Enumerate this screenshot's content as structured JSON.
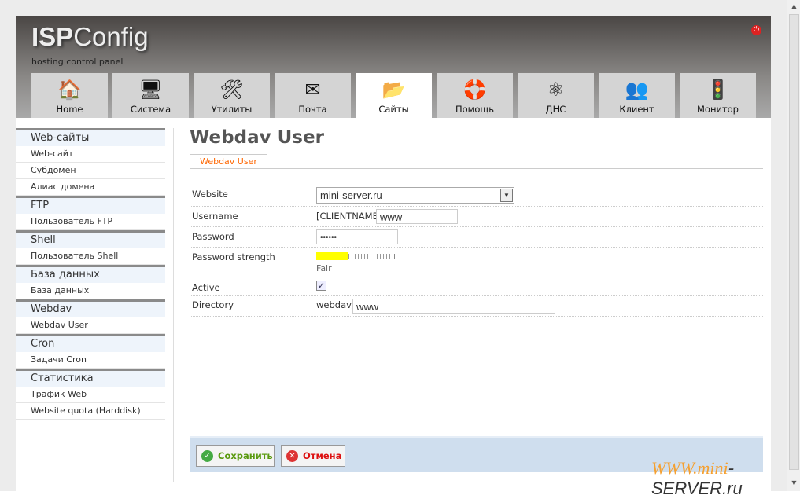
{
  "header": {
    "logo_bold": "ISP",
    "logo_rest": "Config",
    "tagline": "hosting control panel"
  },
  "tabs": [
    {
      "label": "Home",
      "icon": "🏠"
    },
    {
      "label": "Система",
      "icon": "🖥"
    },
    {
      "label": "Утилиты",
      "icon": "🛠"
    },
    {
      "label": "Почта",
      "icon": "✉"
    },
    {
      "label": "Сайты",
      "icon": "📂",
      "active": true
    },
    {
      "label": "Помощь",
      "icon": "🛟"
    },
    {
      "label": "ДНС",
      "icon": "⚛"
    },
    {
      "label": "Клиент",
      "icon": "👥"
    },
    {
      "label": "Монитор",
      "icon": "🚦"
    }
  ],
  "sidebar": [
    {
      "title": "Web-сайты",
      "items": [
        "Web-сайт",
        "Субдомен",
        "Алиас домена"
      ]
    },
    {
      "title": "FTP",
      "items": [
        "Пользователь FTP"
      ]
    },
    {
      "title": "Shell",
      "items": [
        "Пользователь Shell"
      ]
    },
    {
      "title": "База данных",
      "items": [
        "База данных"
      ]
    },
    {
      "title": "Webdav",
      "items": [
        "Webdav User"
      ]
    },
    {
      "title": "Cron",
      "items": [
        "Задачи Cron"
      ]
    },
    {
      "title": "Статистика",
      "items": [
        "Трафик Web",
        "Website quota (Harddisk)"
      ]
    }
  ],
  "page": {
    "title": "Webdav User",
    "tab": "Webdav User"
  },
  "form": {
    "website_label": "Website",
    "website_value": "mini-server.ru",
    "username_label": "Username",
    "username_prefix": "[CLIENTNAME]",
    "username_value": "www",
    "password_label": "Password",
    "password_value": "••••••",
    "strength_label": "Password strength",
    "strength_text": "Fair",
    "strength_fraction": 0.4,
    "active_label": "Active",
    "active_checked": true,
    "directory_label": "Directory",
    "directory_prefix": "webdav/",
    "directory_value": "www"
  },
  "buttons": {
    "save": "Сохранить",
    "cancel": "Отмена"
  },
  "watermark": {
    "a": "WWW.mini",
    "b": "-SERVER.ru"
  }
}
